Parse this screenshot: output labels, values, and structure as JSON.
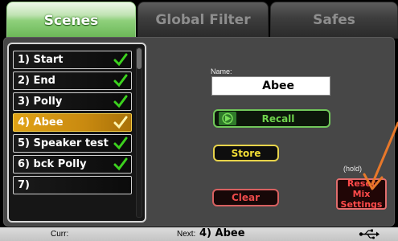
{
  "tabs": [
    {
      "label": "Scenes",
      "active": true
    },
    {
      "label": "Global Filter",
      "active": false
    },
    {
      "label": "Safes",
      "active": false
    }
  ],
  "scenes": [
    {
      "label": "1) Start",
      "stored": true
    },
    {
      "label": "2) End",
      "stored": true
    },
    {
      "label": "3) Polly",
      "stored": true
    },
    {
      "label": "4) Abee",
      "stored": true,
      "selected": true
    },
    {
      "label": "5) Speaker test",
      "stored": true
    },
    {
      "label": "6) bck Polly",
      "stored": true
    },
    {
      "label": "7)",
      "stored": false
    }
  ],
  "name_panel": {
    "label": "Name:",
    "value": "Abee"
  },
  "buttons": {
    "recall": "Recall",
    "store": "Store",
    "clear": "Clear",
    "hold_hint": "(hold)",
    "reset_line1": "Reset Mix",
    "reset_line2": "Settings"
  },
  "status": {
    "curr_label": "Curr:",
    "next_label": "Next:",
    "next_value": "4) Abee"
  },
  "colors": {
    "accent": "#7cc96a",
    "selected": "#d99a14",
    "store": "#e7d34a",
    "danger": "#e55555",
    "annotation": "#e8782a"
  }
}
